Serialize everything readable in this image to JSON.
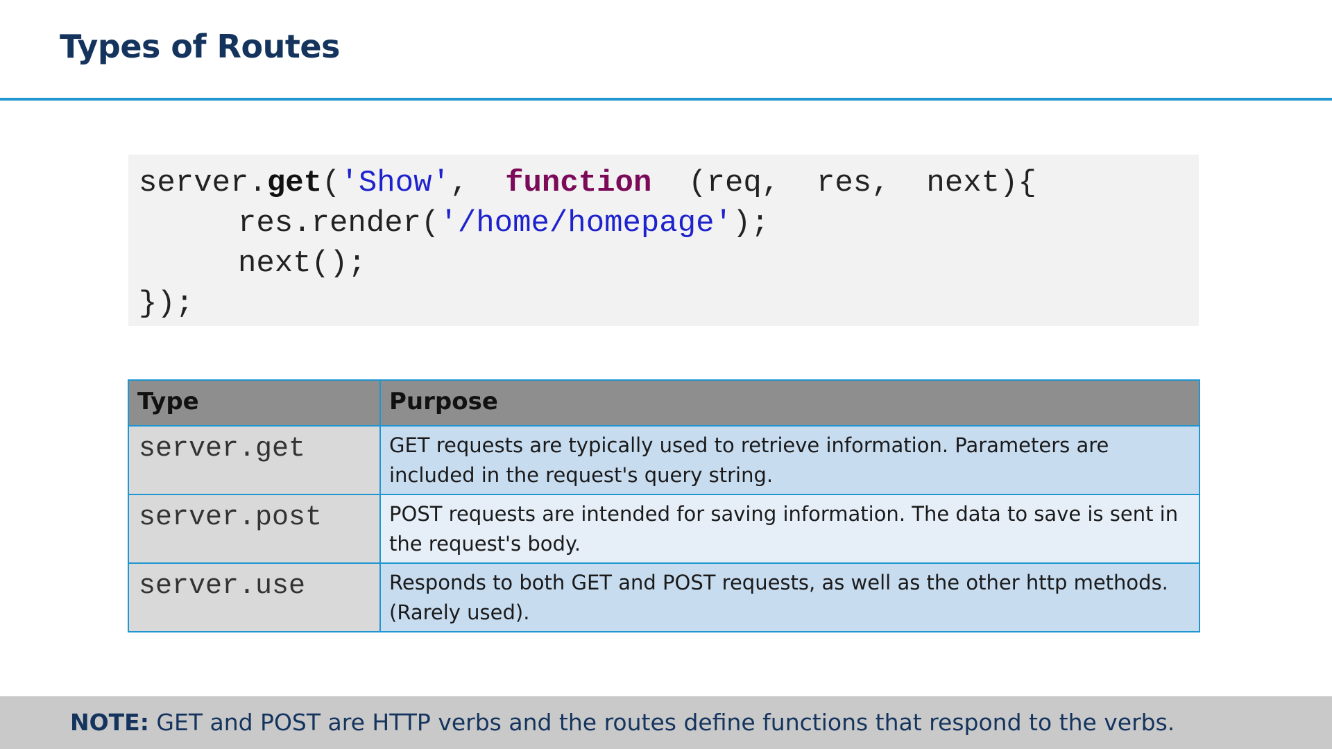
{
  "slide": {
    "title": "Types of Routes"
  },
  "code": {
    "line1": {
      "prefix": "server.",
      "method": "get",
      "open": "(",
      "route": "'Show'",
      "comma": ",  ",
      "keyword": "function",
      "rest": "  (req,  res,  next){"
    },
    "line2": {
      "prefix": "res.render(",
      "path": "'/home/homepage'",
      "suffix": ");"
    },
    "line3": "next();",
    "line4": "});"
  },
  "table": {
    "headers": [
      "Type",
      "Purpose"
    ],
    "rows": [
      {
        "type": "server.get",
        "purpose": "GET requests are typically used to retrieve information. Parameters are included in the request's query string."
      },
      {
        "type": "server.post",
        "purpose": "POST requests are intended for saving information. The data to save is sent in the request's body."
      },
      {
        "type": "server.use",
        "purpose": "Responds to both GET and POST requests, as well as the other http methods. (Rarely used)."
      }
    ]
  },
  "note": {
    "label": "NOTE:",
    "text": " GET and POST are HTTP verbs and the routes define functions that respond to the verbs."
  },
  "colors": {
    "title": "#14345e",
    "accent_rule": "#1f95d1",
    "string": "#1e22cc",
    "function_keyword": "#7b0a59",
    "header_bg": "#8e8e8e"
  }
}
